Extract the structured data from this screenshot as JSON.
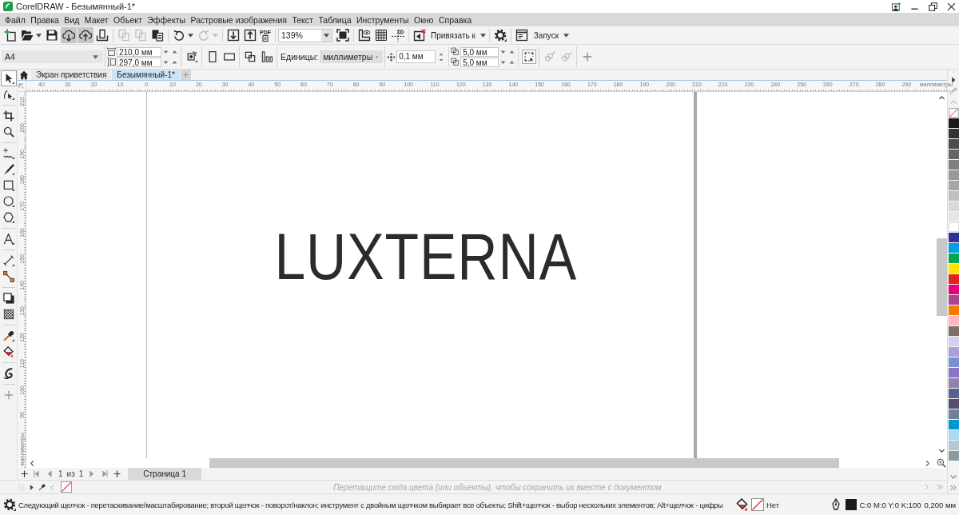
{
  "window": {
    "title": "CorelDRAW - Безымянный-1*"
  },
  "menu": [
    "Файл",
    "Правка",
    "Вид",
    "Макет",
    "Объект",
    "Эффекты",
    "Растровые изображения",
    "Текст",
    "Таблица",
    "Инструменты",
    "Окно",
    "Справка"
  ],
  "standard_toolbar": {
    "buttons": [
      {
        "disabled": false,
        "pressed": false
      },
      {
        "disabled": false,
        "pressed": false
      },
      {
        "disabled": false,
        "pressed": false
      },
      {
        "disabled": false,
        "pressed": true
      },
      {
        "disabled": false,
        "pressed": true
      },
      {
        "disabled": false,
        "pressed": false
      },
      {
        "disabled": true,
        "pressed": false
      },
      {
        "disabled": true,
        "pressed": false
      },
      {
        "disabled": false,
        "pressed": false
      },
      {
        "disabled": false,
        "pressed": false
      },
      {
        "disabled": true,
        "pressed": false
      },
      {
        "disabled": false,
        "pressed": false
      },
      {
        "disabled": false,
        "pressed": false
      },
      {
        "disabled": false,
        "pressed": false
      },
      {
        "disabled": false,
        "pressed": false
      },
      {
        "disabled": false,
        "pressed": false
      },
      {
        "disabled": false,
        "pressed": false
      },
      {
        "disabled": false,
        "pressed": false
      },
      {
        "disabled": false,
        "pressed": false
      },
      {
        "disabled": false,
        "pressed": false
      }
    ],
    "pdf_label": "PDF",
    "zoom_level": "139%",
    "snap_label": "Привязать к",
    "launch_label": "Запуск"
  },
  "property_bar": {
    "page_size": "A4",
    "page_width": "210,0 мм",
    "page_height": "297,0 мм",
    "units_label": "Единицы:",
    "units": "миллиметры",
    "nudge": "0,1 мм",
    "duplicate_x": "5,0 мм",
    "duplicate_y": "5,0 мм",
    "buttons": [
      {
        "disabled": false
      },
      {
        "disabled": false
      },
      {
        "disabled": false
      },
      {
        "disabled": false
      },
      {
        "disabled": false
      },
      {
        "disabled": false
      },
      {
        "disabled": true
      },
      {
        "disabled": true
      },
      {
        "disabled": false
      }
    ]
  },
  "toolbox": [
    {
      "selected": true
    },
    {
      "selected": false
    },
    {
      "selected": false
    },
    {
      "selected": false
    },
    {
      "selected": false
    },
    {
      "selected": false
    },
    {
      "selected": false
    },
    {
      "selected": false
    },
    {
      "selected": false
    },
    {
      "selected": false
    },
    {
      "selected": false
    },
    {
      "selected": false
    },
    {
      "selected": false
    },
    {
      "selected": false
    },
    {
      "selected": false
    },
    {
      "selected": false
    },
    {
      "selected": false
    }
  ],
  "document_tabs": [
    {
      "label": "Экран приветствия",
      "selected": false
    },
    {
      "label": "Безымянный-1*",
      "selected": true
    }
  ],
  "horizontal_ruler": {
    "labels": [
      "40",
      "30",
      "20",
      "10",
      "0",
      "10",
      "20",
      "30",
      "40",
      "50",
      "60",
      "70",
      "80",
      "90",
      "100",
      "110",
      "120",
      "130",
      "140",
      "150",
      "160",
      "170",
      "180",
      "190",
      "200",
      "210",
      "220",
      "230",
      "240",
      "250",
      "260",
      "270",
      "280",
      "290"
    ],
    "unit": "миллиметры"
  },
  "vertical_ruler": {
    "labels": [
      "210",
      "200",
      "190",
      "180",
      "170",
      "160",
      "150",
      "140",
      "130",
      "120",
      "110",
      "100",
      "90"
    ],
    "unit": "миллиметры"
  },
  "canvas": {
    "logo": "LUXTERNA"
  },
  "page_navigator": {
    "current": "1",
    "of_label": "из",
    "total": "1",
    "pages": [
      {
        "label": "Страница 1",
        "selected": true
      }
    ]
  },
  "document_palette": {
    "placeholder": "Перетащите сюда цвета (или объекты), чтобы сохранить их вместе с документом"
  },
  "color_palette": [
    {
      "kind": "none"
    },
    {
      "kind": "swatch",
      "color": "#1a1a1a"
    },
    {
      "kind": "swatch",
      "color": "#333333"
    },
    {
      "kind": "swatch",
      "color": "#4d4d4d"
    },
    {
      "kind": "swatch",
      "color": "#666666"
    },
    {
      "kind": "swatch",
      "color": "#7f7f7f"
    },
    {
      "kind": "swatch",
      "color": "#999999"
    },
    {
      "kind": "swatch",
      "color": "#a6a6a6"
    },
    {
      "kind": "swatch",
      "color": "#bfbfbf"
    },
    {
      "kind": "swatch",
      "color": "#d9d9d9"
    },
    {
      "kind": "swatch",
      "color": "#e6e6e6"
    },
    {
      "kind": "swatch",
      "color": "#ffffff"
    },
    {
      "kind": "swatch",
      "color": "#2e3192"
    },
    {
      "kind": "swatch",
      "color": "#00a0e3"
    },
    {
      "kind": "swatch",
      "color": "#00a650"
    },
    {
      "kind": "swatch",
      "color": "#ffe500"
    },
    {
      "kind": "swatch",
      "color": "#e3241b"
    },
    {
      "kind": "swatch",
      "color": "#e6007e"
    },
    {
      "kind": "swatch",
      "color": "#a6488e"
    },
    {
      "kind": "swatch",
      "color": "#f57c00"
    },
    {
      "kind": "swatch",
      "color": "#ffb6c1"
    },
    {
      "kind": "swatch",
      "color": "#7f6e66"
    },
    {
      "kind": "swatch",
      "color": "#d6cfee"
    },
    {
      "kind": "swatch",
      "color": "#ab9fdb"
    },
    {
      "kind": "swatch",
      "color": "#7b90d0"
    },
    {
      "kind": "swatch",
      "color": "#8c73c6"
    },
    {
      "kind": "swatch",
      "color": "#8f84ab"
    },
    {
      "kind": "swatch",
      "color": "#56618f"
    },
    {
      "kind": "swatch",
      "color": "#574d6a"
    },
    {
      "kind": "swatch",
      "color": "#6f8097"
    },
    {
      "kind": "swatch",
      "color": "#0095d3"
    },
    {
      "kind": "swatch",
      "color": "#a8dbf0"
    },
    {
      "kind": "swatch",
      "color": "#b4c7d3"
    },
    {
      "kind": "swatch",
      "color": "#8a9aa1"
    }
  ],
  "status_bar": {
    "message": "Следующий щелчок - перетаскивание/масштабирование; второй щелчок - поворот/наклон; инструмент с двойным щелчком выбирает все объекты; Shift+щелчок - выбор нескольких элементов; Alt+щелчок - цифры",
    "fill": {
      "kind": "none",
      "label": "Нет"
    },
    "outline": {
      "color": "#1a1a1a",
      "values": "C:0 M:0 Y:0 K:100",
      "width": "0,200 мм"
    }
  }
}
